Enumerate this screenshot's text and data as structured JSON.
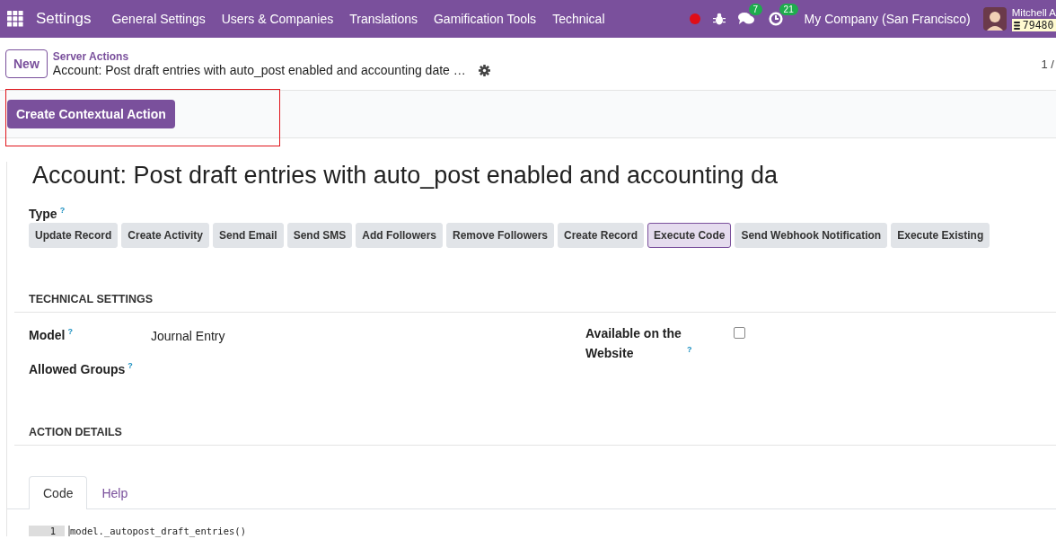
{
  "navbar": {
    "app": "Settings",
    "menus": [
      "General Settings",
      "Users & Companies",
      "Translations",
      "Gamification Tools",
      "Technical"
    ],
    "messages_badge": "7",
    "activities_badge": "21",
    "company": "My Company (San Francisco)",
    "user": "Mitchell A",
    "database": "79480"
  },
  "control_panel": {
    "new_button": "New",
    "breadcrumb": "Server Actions",
    "record": "Account: Post draft entries with auto_post enabled and accounting date …",
    "pager": "1 /"
  },
  "action_bar": {
    "button": "Create Contextual Action",
    "highlighted": true
  },
  "form": {
    "title": "Account: Post draft entries with auto_post enabled and accounting da",
    "type_label": "Type",
    "help_mark": "?",
    "types": [
      {
        "label": "Update Record",
        "selected": false
      },
      {
        "label": "Create Activity",
        "selected": false
      },
      {
        "label": "Send Email",
        "selected": false
      },
      {
        "label": "Send SMS",
        "selected": false
      },
      {
        "label": "Add Followers",
        "selected": false
      },
      {
        "label": "Remove Followers",
        "selected": false
      },
      {
        "label": "Create Record",
        "selected": false
      },
      {
        "label": "Execute Code",
        "selected": true
      },
      {
        "label": "Send Webhook Notification",
        "selected": false
      },
      {
        "label": "Execute Existing",
        "selected": false
      }
    ],
    "technical_settings": "TECHNICAL SETTINGS",
    "model_label": "Model",
    "model_value": "Journal Entry",
    "groups_label": "Allowed Groups",
    "website_label": "Available on the Website",
    "website_checked": false,
    "action_details": "ACTION DETAILS",
    "tabs": [
      {
        "label": "Code",
        "selected": true
      },
      {
        "label": "Help",
        "selected": false
      }
    ],
    "code_lines": [
      {
        "number": "1",
        "text": "model._autopost_draft_entries()"
      }
    ]
  }
}
